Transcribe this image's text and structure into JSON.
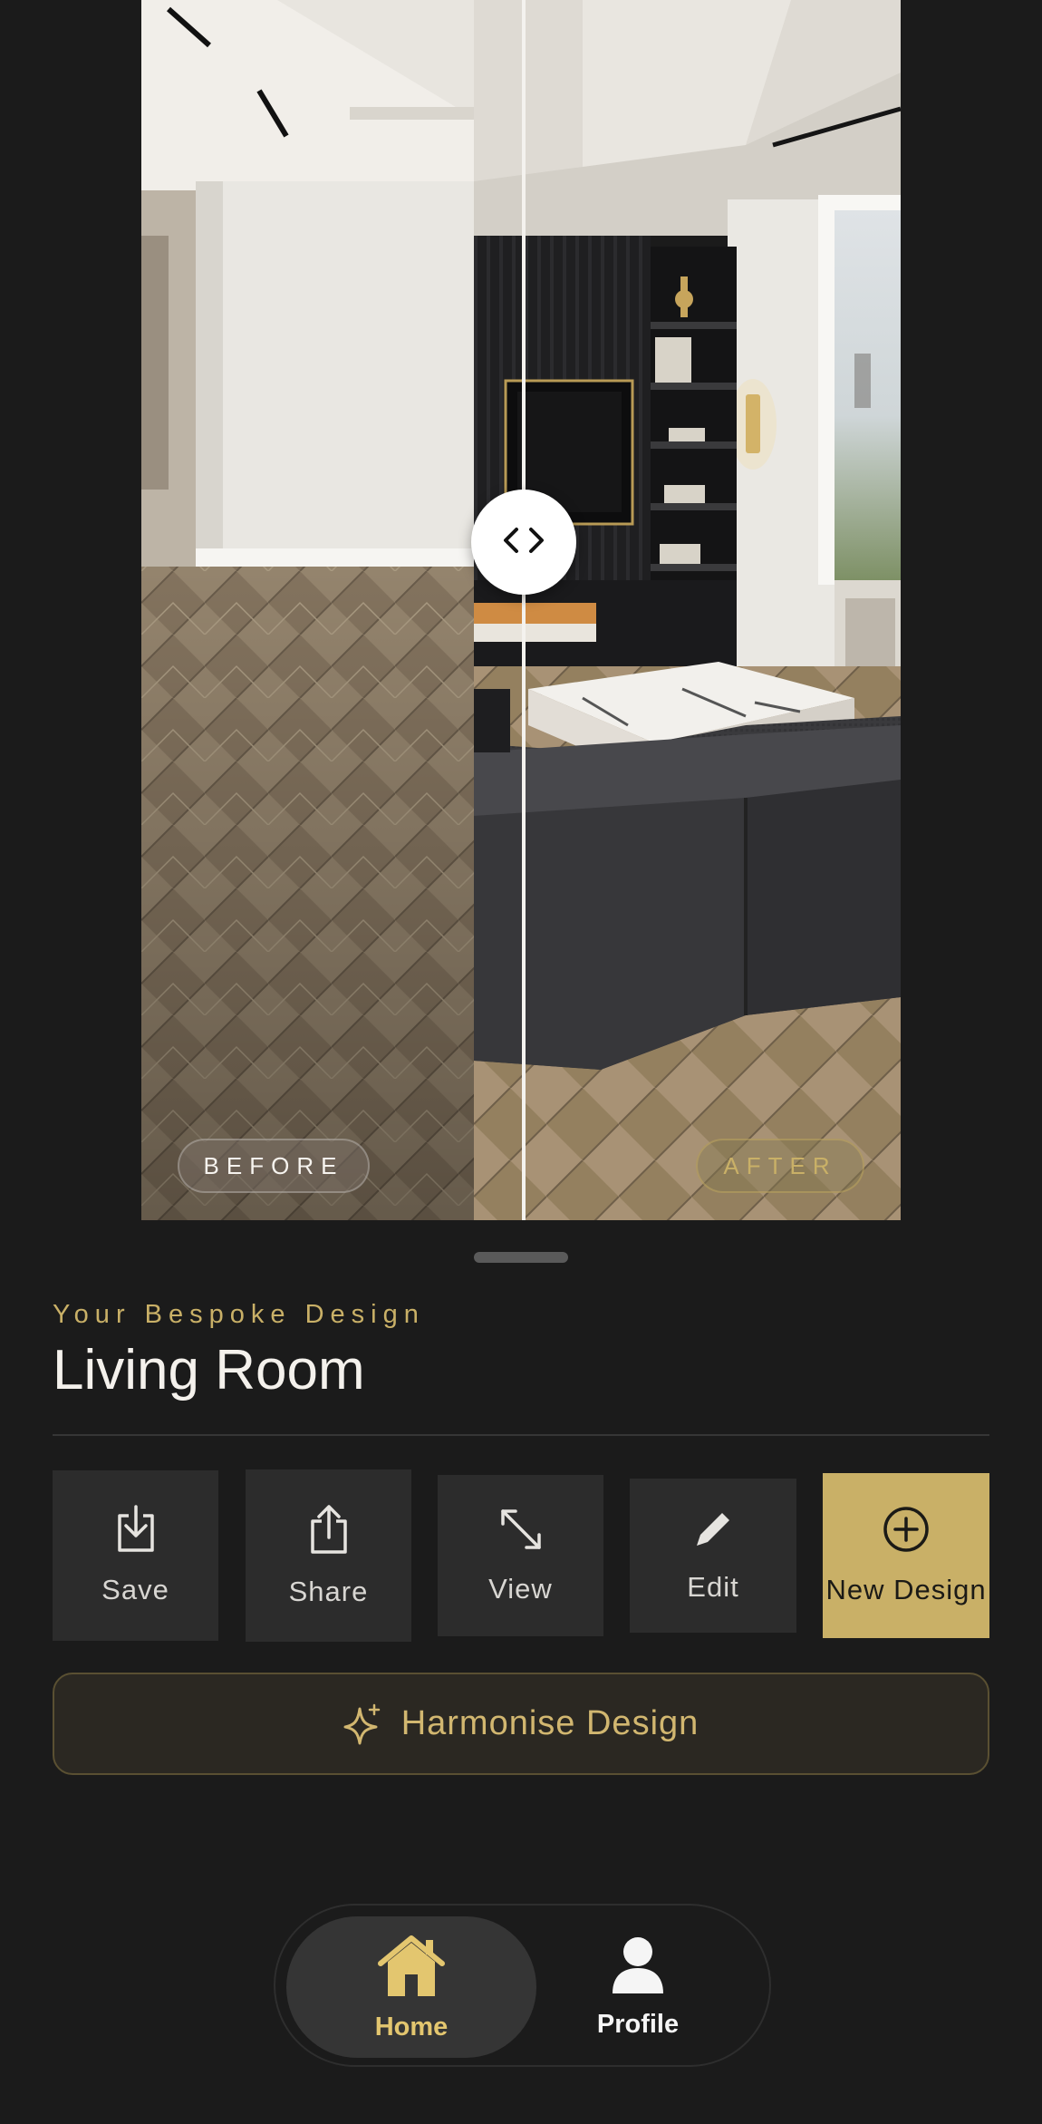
{
  "compare": {
    "before_label": "BEFORE",
    "after_label": "AFTER",
    "handle_icon": "chevron-left-right-icon"
  },
  "design": {
    "subtitle": "Your Bespoke Design",
    "room_name": "Living Room"
  },
  "actions": [
    {
      "label": "Save",
      "icon": "download-icon"
    },
    {
      "label": "Share",
      "icon": "share-icon"
    },
    {
      "label": "View",
      "icon": "expand-icon"
    },
    {
      "label": "Edit",
      "icon": "pencil-icon"
    },
    {
      "label": "New Design",
      "icon": "plus-circle-icon"
    }
  ],
  "harmonise": {
    "label": "Harmonise Design",
    "icon": "sparkle-icon"
  },
  "nav": {
    "items": [
      {
        "label": "Home",
        "icon": "home-icon",
        "active": true
      },
      {
        "label": "Profile",
        "icon": "person-icon",
        "active": false
      }
    ]
  },
  "colors": {
    "background": "#1b1b1b",
    "accent_gold": "#c9b067",
    "tile": "#2c2c2c"
  }
}
